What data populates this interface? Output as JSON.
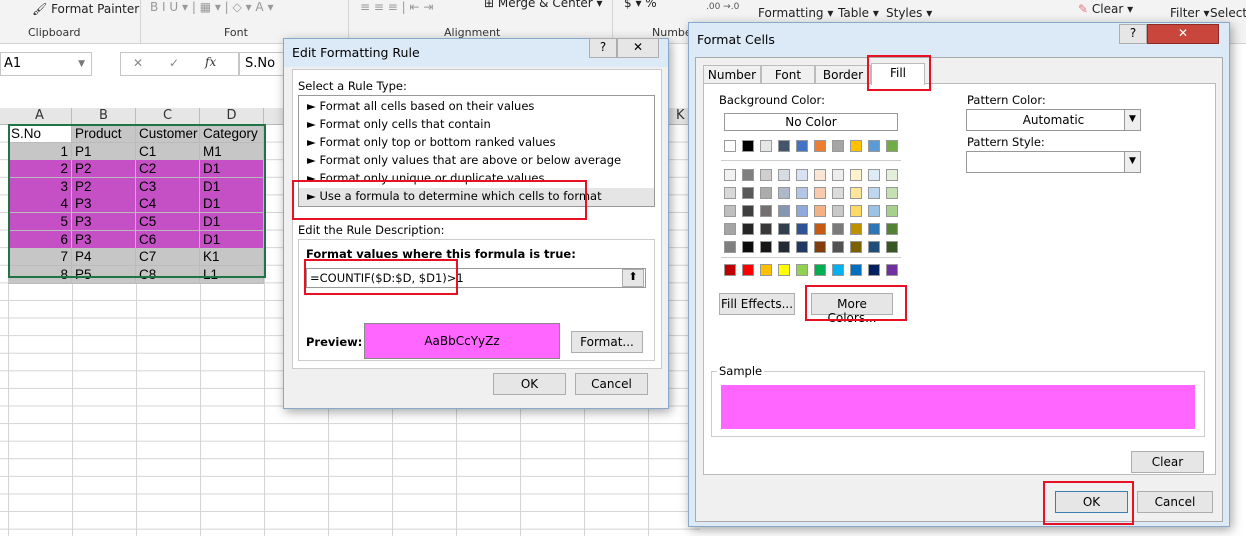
{
  "ribbon": {
    "format_painter": "Format Painter",
    "clipboard": "Clipboard",
    "font": "Font",
    "alignment": "Alignment",
    "merge_center": "Merge & Center",
    "number": "Number",
    "conditional_formatting": "Formatting",
    "format_as_table": "Table",
    "cell_styles": "Styles",
    "clear": "Clear",
    "filter": "Filter",
    "select": "Select"
  },
  "formula_bar": {
    "name_box": "A1",
    "formula": "S.No",
    "fx": "fx"
  },
  "sheet": {
    "columns": [
      "A",
      "B",
      "C",
      "D"
    ],
    "extra_column": "K",
    "rows": [
      [
        "S.No",
        "Product",
        "Customer",
        "Category"
      ],
      [
        "1",
        "P1",
        "C1",
        "M1"
      ],
      [
        "2",
        "P2",
        "C2",
        "D1"
      ],
      [
        "3",
        "P2",
        "C3",
        "D1"
      ],
      [
        "4",
        "P3",
        "C4",
        "D1"
      ],
      [
        "5",
        "P3",
        "C5",
        "D1"
      ],
      [
        "6",
        "P3",
        "C6",
        "D1"
      ],
      [
        "7",
        "P4",
        "C7",
        "K1"
      ],
      [
        "8",
        "P5",
        "C8",
        "L1"
      ]
    ],
    "highlight_color": "#c54fc5",
    "range_fill": "#c6c6c6"
  },
  "edit_rule": {
    "title": "Edit Formatting Rule",
    "select_label": "Select a Rule Type:",
    "rule_types": [
      "Format all cells based on their values",
      "Format only cells that contain",
      "Format only top or bottom ranked values",
      "Format only values that are above or below average",
      "Format only unique or duplicate values",
      "Use a formula to determine which cells to format"
    ],
    "selected_rule": 5,
    "edit_label": "Edit the Rule Description:",
    "formula_label": "Format values where this formula is true:",
    "formula": "=COUNTIF($D:$D, $D1)>1",
    "preview_label": "Preview:",
    "preview_text": "AaBbCcYyZz",
    "preview_color": "#ff66ff",
    "format_button": "Format...",
    "ok": "OK",
    "cancel": "Cancel",
    "help": "?",
    "close": "✕"
  },
  "format_cells": {
    "title": "Format Cells",
    "tabs": [
      "Number",
      "Font",
      "Border",
      "Fill"
    ],
    "active_tab": "Fill",
    "background_color_label": "Background Color:",
    "no_color": "No Color",
    "theme_colors": [
      "#FFFFFF",
      "#000000",
      "#E7E6E6",
      "#44546A",
      "#4472C4",
      "#ED7D31",
      "#A5A5A5",
      "#FFC000",
      "#5B9BD5",
      "#70AD47"
    ],
    "tints": [
      [
        "#F2F2F2",
        "#7F7F7F",
        "#D0CECE",
        "#D6DCE4",
        "#D9E2F3",
        "#FBE5D5",
        "#EDEDED",
        "#FFF2CC",
        "#DEEBF6",
        "#E2EFD9"
      ],
      [
        "#D8D8D8",
        "#595959",
        "#AEABAB",
        "#ADB9CA",
        "#B4C6E7",
        "#F7CBAC",
        "#DBDBDB",
        "#FEE599",
        "#BDD7EE",
        "#C5E0B3"
      ],
      [
        "#BFBFBF",
        "#3F3F3F",
        "#757070",
        "#8496B0",
        "#8EAADB",
        "#F4B183",
        "#C9C9C9",
        "#FFD965",
        "#9CC3E5",
        "#A8D08D"
      ],
      [
        "#A5A5A5",
        "#262626",
        "#3A3838",
        "#323F4F",
        "#2F5496",
        "#C55A11",
        "#7B7B7B",
        "#BF9000",
        "#2E75B5",
        "#538135"
      ],
      [
        "#7F7F7F",
        "#0C0C0C",
        "#171616",
        "#222A35",
        "#1F3864",
        "#833C0B",
        "#525252",
        "#7F6000",
        "#1E4E79",
        "#375623"
      ]
    ],
    "standard_colors": [
      "#C00000",
      "#FF0000",
      "#FFC000",
      "#FFFF00",
      "#92D050",
      "#00B050",
      "#00B0F0",
      "#0070C0",
      "#002060",
      "#7030A0"
    ],
    "fill_effects": "Fill Effects...",
    "more_colors": "More Colors...",
    "pattern_color_label": "Pattern Color:",
    "pattern_color": "Automatic",
    "pattern_style_label": "Pattern Style:",
    "sample_label": "Sample",
    "sample_color": "#ff66ff",
    "clear": "Clear",
    "ok": "OK",
    "cancel": "Cancel",
    "help": "?",
    "close": "✕"
  }
}
